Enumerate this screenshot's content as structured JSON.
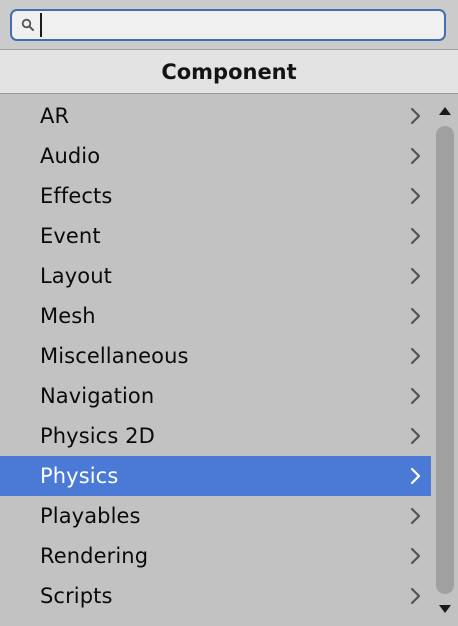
{
  "search": {
    "value": "",
    "icon": "search-icon"
  },
  "header": {
    "title": "Component"
  },
  "list": {
    "items": [
      {
        "label": "AR",
        "selected": false
      },
      {
        "label": "Audio",
        "selected": false
      },
      {
        "label": "Effects",
        "selected": false
      },
      {
        "label": "Event",
        "selected": false
      },
      {
        "label": "Layout",
        "selected": false
      },
      {
        "label": "Mesh",
        "selected": false
      },
      {
        "label": "Miscellaneous",
        "selected": false
      },
      {
        "label": "Navigation",
        "selected": false
      },
      {
        "label": "Physics 2D",
        "selected": false
      },
      {
        "label": "Physics",
        "selected": true
      },
      {
        "label": "Playables",
        "selected": false
      },
      {
        "label": "Rendering",
        "selected": false
      },
      {
        "label": "Scripts",
        "selected": false
      }
    ],
    "chevron_icon": "chevron-right-icon"
  },
  "colors": {
    "selection": "#4a7ad6",
    "background": "#c2c2c2",
    "header_background": "#e3e3e3",
    "search_border": "#3f6fae"
  }
}
